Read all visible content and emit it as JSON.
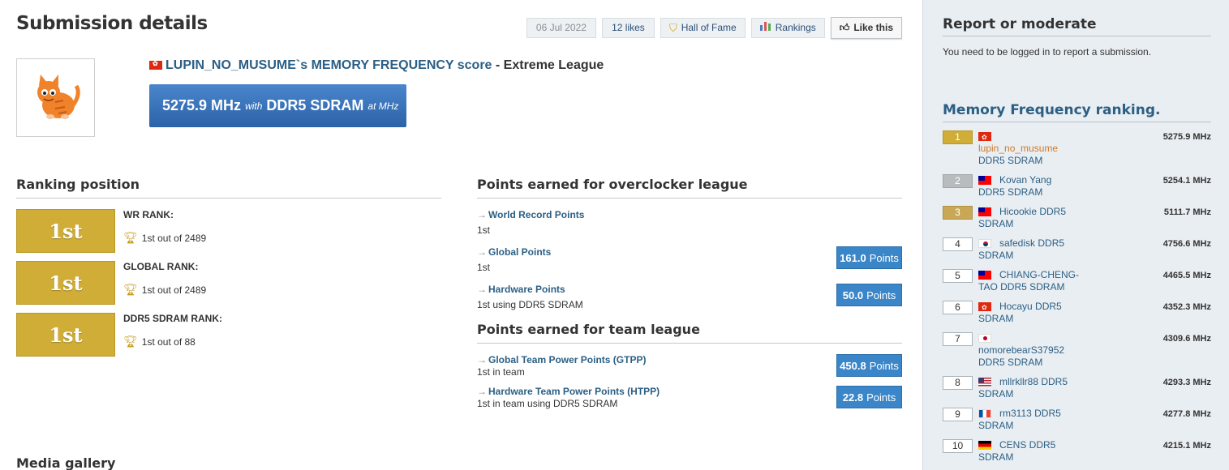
{
  "page": {
    "title": "Submission details",
    "date": "06 Jul 2022",
    "likes": "12 likes",
    "hall_of_fame": "Hall of Fame",
    "rankings": "Rankings",
    "like_this": "Like this"
  },
  "submission": {
    "user_title": "LUPIN_NO_MUSUME`s MEMORY FREQUENCY score",
    "league": " - Extreme League",
    "score": "5275.9 MHz",
    "with": "with",
    "memory": "DDR5 SDRAM",
    "at": "at MHz"
  },
  "ranking_position": {
    "title": "Ranking position",
    "items": [
      {
        "badge": "1st",
        "label": "WR RANK:",
        "value": "1st out of 2489"
      },
      {
        "badge": "1st",
        "label": "GLOBAL RANK:",
        "value": "1st out of 2489"
      },
      {
        "badge": "1st",
        "label": "DDR5 SDRAM RANK:",
        "value": "1st out of 88"
      }
    ]
  },
  "overclocker_points": {
    "title": "Points earned for overclocker league",
    "items": [
      {
        "label": "World Record Points",
        "sub": "1st",
        "points": "",
        "unit": ""
      },
      {
        "label": "Global Points",
        "sub": "1st",
        "points": "161.0",
        "unit": "Points"
      },
      {
        "label": "Hardware Points",
        "sub": "1st using DDR5 SDRAM",
        "points": "50.0",
        "unit": "Points"
      }
    ]
  },
  "team_points": {
    "title": "Points earned for team league",
    "items": [
      {
        "label": "Global Team Power Points (GTPP)",
        "sub": "1st in team",
        "points": "450.8",
        "unit": "Points"
      },
      {
        "label": "Hardware Team Power Points (HTPP)",
        "sub": "1st in team using DDR5 SDRAM",
        "points": "22.8",
        "unit": "Points"
      }
    ]
  },
  "media_gallery": {
    "title": "Media gallery"
  },
  "sidebar": {
    "report_title": "Report or moderate",
    "report_text": "You need to be logged in to report a submission.",
    "ranking_title": "Memory Frequency ranking.",
    "ranking": [
      {
        "rank": "1",
        "flag": "hk",
        "name": "lupin_no_musume",
        "line2": "DDR5 SDRAM",
        "value": "5275.9 MHz"
      },
      {
        "rank": "2",
        "flag": "tw",
        "name": "Kovan Yang",
        "line2": "DDR5 SDRAM",
        "value": "5254.1 MHz"
      },
      {
        "rank": "3",
        "flag": "tw",
        "name": "Hicookie DDR5",
        "line2": "SDRAM",
        "value": "5111.7 MHz"
      },
      {
        "rank": "4",
        "flag": "kr",
        "name": "safedisk DDR5",
        "line2": "SDRAM",
        "value": "4756.6 MHz"
      },
      {
        "rank": "5",
        "flag": "tw",
        "name": "CHIANG-CHENG-",
        "line2": "TAO DDR5 SDRAM",
        "value": "4465.5 MHz"
      },
      {
        "rank": "6",
        "flag": "hk",
        "name": "Hocayu DDR5",
        "line2": "SDRAM",
        "value": "4352.3 MHz"
      },
      {
        "rank": "7",
        "flag": "jp",
        "name": "",
        "line2": "nomorebearS37952",
        "line3": "DDR5 SDRAM",
        "value": "4309.6 MHz"
      },
      {
        "rank": "8",
        "flag": "us",
        "name": "mllrkllr88 DDR5",
        "line2": "SDRAM",
        "value": "4293.3 MHz"
      },
      {
        "rank": "9",
        "flag": "fr",
        "name": "rm3113 DDR5",
        "line2": "SDRAM",
        "value": "4277.8 MHz"
      },
      {
        "rank": "10",
        "flag": "de",
        "name": "CENS DDR5",
        "line2": "SDRAM",
        "value": "4215.1 MHz"
      }
    ]
  }
}
